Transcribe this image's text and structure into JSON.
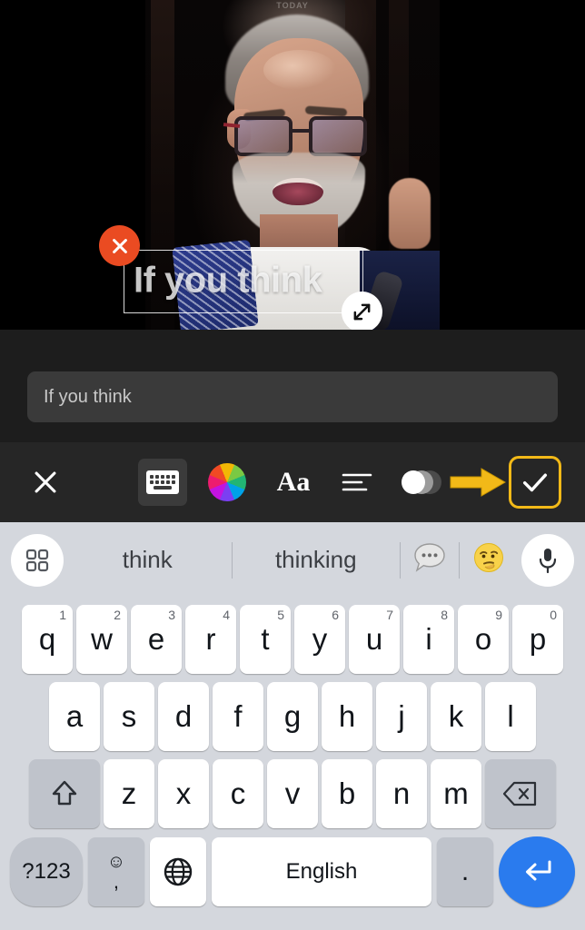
{
  "video": {
    "watermark": "TODAY",
    "overlay_text": "If you think",
    "delete_icon": "close-circle-icon",
    "resize_icon": "resize-diagonal-icon"
  },
  "input": {
    "value": "If you think",
    "placeholder": "If you think"
  },
  "toolbar": {
    "close_label": "close-icon",
    "keyboard_label": "keyboard-icon",
    "color_label": "color-wheel-icon",
    "font_label": "Aa",
    "align_label": "align-icon",
    "opacity_label": "opacity-icon",
    "done_label": "check-icon",
    "accent_color": "#f2b918",
    "selected_tool": "keyboard"
  },
  "annotation": {
    "arrow_color": "#f2b918",
    "arrow_name": "arrow-right-annotation",
    "highlight_target": "done-button"
  },
  "suggestions": {
    "grid_icon": "apps-grid-icon",
    "words": [
      "think",
      "thinking"
    ],
    "bubble_icon": "speech-bubble-icon",
    "emoji_icon": "thinking-face-emoji",
    "mic_icon": "microphone-icon"
  },
  "keyboard": {
    "row1": [
      {
        "key": "q",
        "num": "1"
      },
      {
        "key": "w",
        "num": "2"
      },
      {
        "key": "e",
        "num": "3"
      },
      {
        "key": "r",
        "num": "4"
      },
      {
        "key": "t",
        "num": "5"
      },
      {
        "key": "y",
        "num": "6"
      },
      {
        "key": "u",
        "num": "7"
      },
      {
        "key": "i",
        "num": "8"
      },
      {
        "key": "o",
        "num": "9"
      },
      {
        "key": "p",
        "num": "0"
      }
    ],
    "row2": [
      "a",
      "s",
      "d",
      "f",
      "g",
      "h",
      "j",
      "k",
      "l"
    ],
    "row3": {
      "shift": "shift-icon",
      "letters": [
        "z",
        "x",
        "c",
        "v",
        "b",
        "n",
        "m"
      ],
      "backspace": "backspace-icon"
    },
    "row4": {
      "symbols": "?123",
      "emoji": "emoji-icon",
      "comma": ",",
      "globe": "globe-icon",
      "space": "English",
      "period": ".",
      "enter": "enter-icon"
    }
  }
}
